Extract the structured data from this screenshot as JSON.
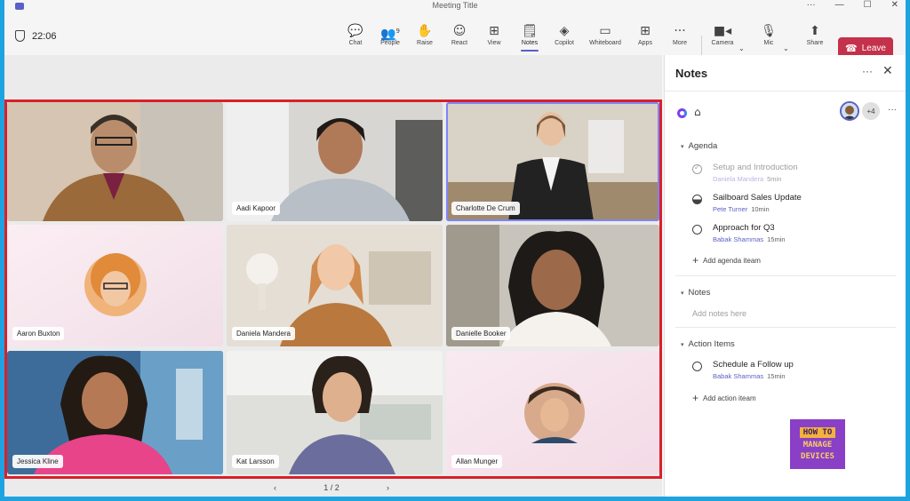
{
  "window": {
    "title": "Meeting Title"
  },
  "toolbar": {
    "timer": "22:06",
    "items": [
      {
        "label": "Chat",
        "icon": "💬"
      },
      {
        "label": "People",
        "icon": "👥",
        "count": "9"
      },
      {
        "label": "Raise",
        "icon": "✋"
      },
      {
        "label": "React",
        "icon": "☺"
      },
      {
        "label": "View",
        "icon": "⊞"
      },
      {
        "label": "Notes",
        "icon": "🗒"
      },
      {
        "label": "Copilot",
        "icon": "◈"
      },
      {
        "label": "Whiteboard",
        "icon": "▭"
      },
      {
        "label": "Apps",
        "icon": "⊞"
      },
      {
        "label": "More",
        "icon": "···"
      }
    ],
    "camera_label": "Camera",
    "mic_label": "Mic",
    "share_label": "Share",
    "leave_label": "Leave"
  },
  "participants": [
    {
      "name": "",
      "bg": "#c9a680"
    },
    {
      "name": "Aadi Kapoor",
      "bg": "#d8d6d2"
    },
    {
      "name": "Charlotte De Crum",
      "bg": "#d9d2c6",
      "speaking": true
    },
    {
      "name": "Aaron Buxton",
      "bg": "#f6e6ec"
    },
    {
      "name": "Daniela Mandera",
      "bg": "#e4ded4"
    },
    {
      "name": "Danielle Booker",
      "bg": "#c9c4bb"
    },
    {
      "name": "Jessica Kline",
      "bg": "#3d6c9a"
    },
    {
      "name": "Kat Larsson",
      "bg": "#dfe0dc"
    },
    {
      "name": "Allan Munger",
      "bg": "#f8e4ec"
    }
  ],
  "pager": {
    "label": "1 / 2"
  },
  "notes": {
    "title": "Notes",
    "extra_count": "+4",
    "agenda_heading": "Agenda",
    "agenda": [
      {
        "title": "Setup and Introduction",
        "person": "Daniela Mandera",
        "duration": "5min",
        "state": "done"
      },
      {
        "title": "Sailboard Sales Update",
        "person": "Pete Turner",
        "duration": "10min",
        "state": "half"
      },
      {
        "title": "Approach for Q3",
        "person": "Babak Shammas",
        "duration": "15min",
        "state": "open"
      }
    ],
    "add_agenda": "Add agenda iteam",
    "notes_heading": "Notes",
    "notes_placeholder": "Add notes here",
    "action_heading": "Action Items",
    "actions": [
      {
        "title": "Schedule a Follow up",
        "person": "Babak Shammas",
        "duration": "15min"
      }
    ],
    "add_action": "Add action iteam"
  },
  "logo": {
    "line1": "HOW TO",
    "line2": "MANAGE",
    "line3": "DEVICES"
  }
}
